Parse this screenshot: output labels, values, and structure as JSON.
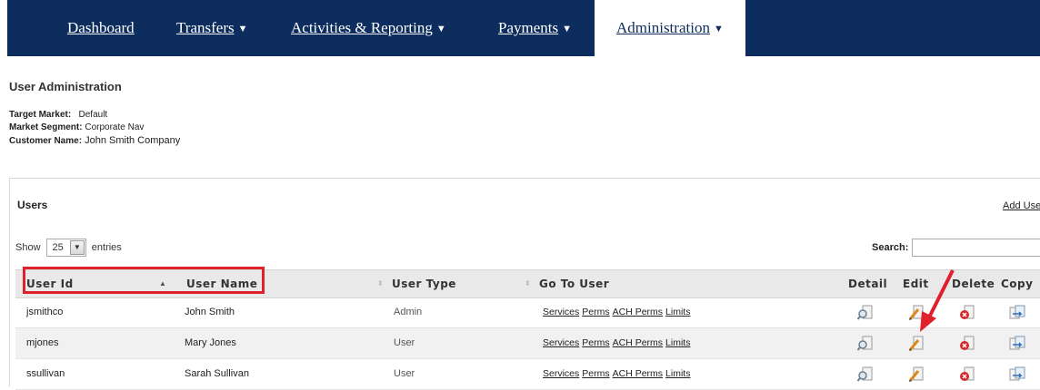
{
  "nav": {
    "items": [
      {
        "label": "Dashboard",
        "has_menu": false
      },
      {
        "label": "Transfers",
        "has_menu": true
      },
      {
        "label": "Activities & Reporting",
        "has_menu": true
      },
      {
        "label": "Payments",
        "has_menu": true
      },
      {
        "label": "Administration",
        "has_menu": true,
        "active": true
      }
    ],
    "chevron": "❯"
  },
  "page": {
    "title": "User Administration",
    "target_market_label": "Target Market:",
    "target_market_value": "Default",
    "market_segment_label": "Market Segment:",
    "market_segment_value": "Corporate Nav",
    "customer_name_label": "Customer Name:",
    "customer_name_value": "John Smith Company"
  },
  "users_panel": {
    "title": "Users",
    "add_user_label": "Add User",
    "show_label": "Show",
    "entries_value": "25",
    "entries_label": "entries",
    "search_label": "Search:",
    "search_value": ""
  },
  "table": {
    "columns": {
      "user_id": "User Id",
      "user_name": "User Name",
      "user_type": "User Type",
      "go_to_user": "Go To User",
      "detail": "Detail",
      "edit": "Edit",
      "delete": "Delete",
      "copy": "Copy"
    },
    "rows": [
      {
        "user_id": "jsmithco",
        "user_name": "John Smith",
        "user_type": "Admin",
        "links": [
          "Services",
          "Perms",
          "ACH Perms",
          "Limits"
        ]
      },
      {
        "user_id": "mjones",
        "user_name": "Mary Jones",
        "user_type": "User",
        "links": [
          "Services",
          "Perms",
          "ACH Perms",
          "Limits"
        ]
      },
      {
        "user_id": "ssullivan",
        "user_name": "Sarah Sullivan",
        "user_type": "User",
        "links": [
          "Services",
          "Perms",
          "ACH Perms",
          "Limits"
        ]
      }
    ]
  },
  "colors": {
    "nav_bg": "#0d2d5e",
    "highlight": "#e0202a"
  },
  "icons": {
    "detail": "magnifier-document-icon",
    "edit": "pencil-document-icon",
    "delete": "red-x-document-icon",
    "copy": "copy-document-icon",
    "sort_asc": "sort-ascending-icon",
    "sort_both": "sort-neutral-icon",
    "annotation": "red-arrow-icon"
  }
}
